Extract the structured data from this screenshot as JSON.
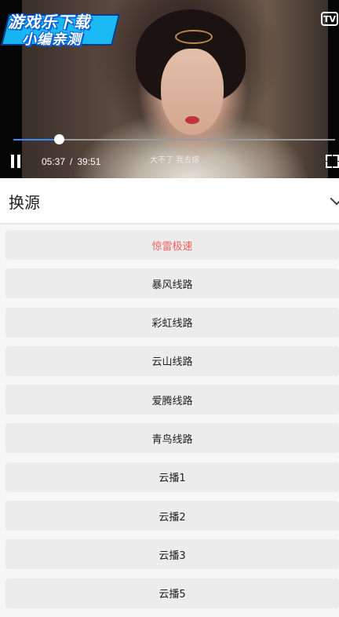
{
  "player": {
    "watermark": {
      "line1": "游戏乐下载",
      "line2": "小编亲测"
    },
    "tv_label": "TV",
    "current_time": "05:37",
    "time_separator": "/",
    "total_time": "39:51",
    "progress_fraction": 0.141,
    "subtitle": "大不了 我去嫁"
  },
  "source_panel": {
    "title": "换源",
    "items": [
      {
        "label": "惊雷极速",
        "active": true
      },
      {
        "label": "暴风线路",
        "active": false
      },
      {
        "label": "彩虹线路",
        "active": false
      },
      {
        "label": "云山线路",
        "active": false
      },
      {
        "label": "爱腾线路",
        "active": false
      },
      {
        "label": "青鸟线路",
        "active": false
      },
      {
        "label": "云播1",
        "active": false
      },
      {
        "label": "云播2",
        "active": false
      },
      {
        "label": "云播3",
        "active": false
      },
      {
        "label": "云播5",
        "active": false
      }
    ]
  },
  "colors": {
    "active_source": "#f0605e",
    "progress_fill": "#3b8bff",
    "item_bg": "#ececec"
  }
}
